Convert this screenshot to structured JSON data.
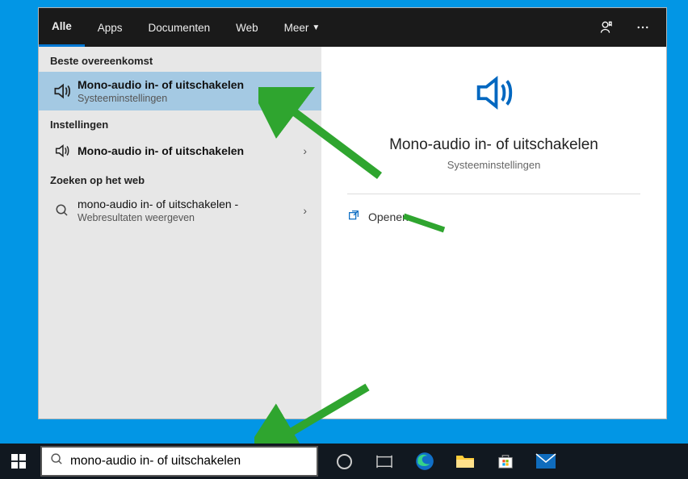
{
  "tabs": {
    "all": "Alle",
    "apps": "Apps",
    "documents": "Documenten",
    "web": "Web",
    "more": "Meer"
  },
  "sections": {
    "bestMatch": "Beste overeenkomst",
    "settings": "Instellingen",
    "webSearch": "Zoeken op het web"
  },
  "results": {
    "best": {
      "title": "Mono-audio in- of uitschakelen",
      "sub": "Systeeminstellingen"
    },
    "setting": {
      "title": "Mono-audio in- of uitschakelen"
    },
    "web": {
      "title": "mono-audio in- of uitschakelen -",
      "sub": "Webresultaten weergeven"
    }
  },
  "preview": {
    "title": "Mono-audio in- of uitschakelen",
    "sub": "Systeeminstellingen",
    "open": "Openen"
  },
  "search": {
    "value": "mono-audio in- of uitschakelen"
  }
}
